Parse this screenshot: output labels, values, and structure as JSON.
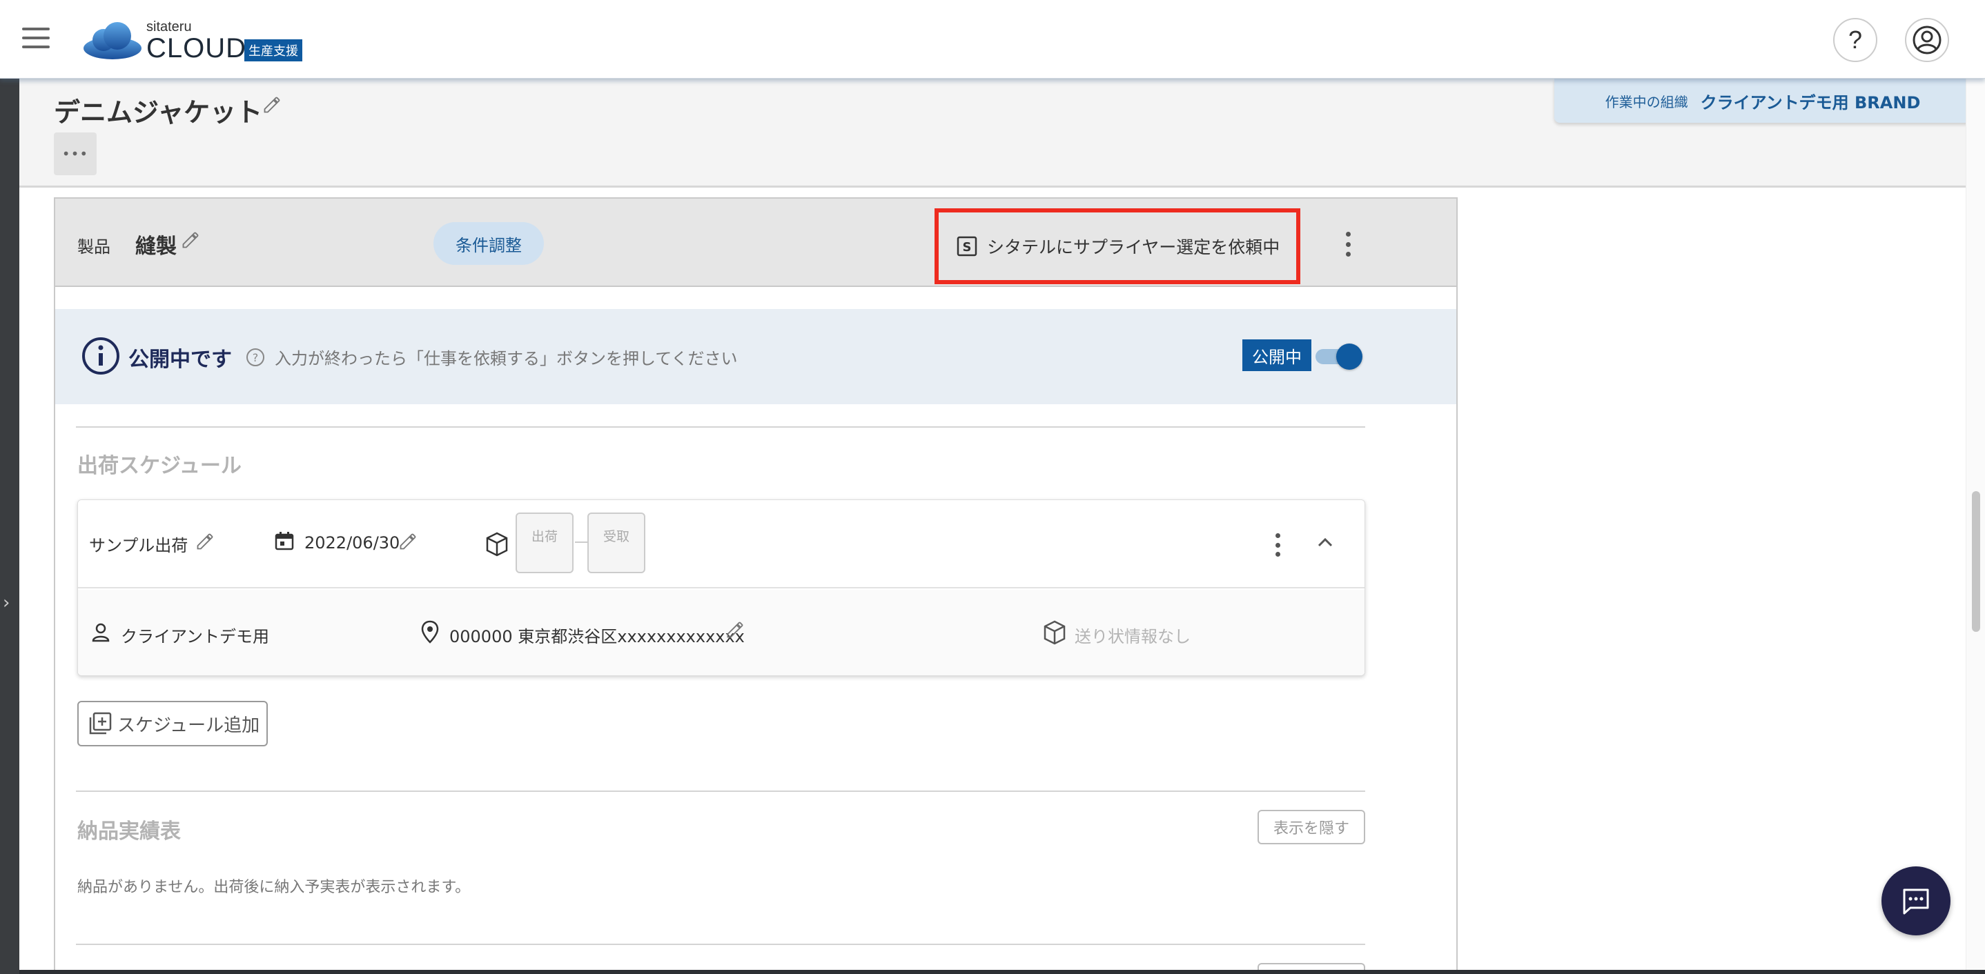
{
  "header": {
    "logo_small": "sitateru",
    "logo_big": "CLOUD",
    "logo_tag": "生産支援",
    "help_label": "?"
  },
  "page": {
    "title": "デニムジャケット",
    "more_label": "•••"
  },
  "org": {
    "label": "作業中の組織",
    "name": "クライアントデモ用 BRAND"
  },
  "product": {
    "label": "製品",
    "name": "縫製",
    "chip": "条件調整",
    "status": "シタテルにサプライヤー選定を依頼中",
    "status_icon_letter": "S"
  },
  "notice": {
    "title": "公開中です",
    "text": "入力が終わったら「仕事を依頼する」ボタンを押してください",
    "badge": "公開中",
    "toggle_on": true
  },
  "schedule": {
    "section_title": "出荷スケジュール",
    "item": {
      "name": "サンプル出荷",
      "date": "2022/06/30",
      "steps": [
        "出荷",
        "受取"
      ],
      "client": "クライアントデモ用",
      "address": "000000 東京都渋谷区xxxxxxxxxxxxx",
      "tracking": "送り状情報なし"
    },
    "add_label": "スケジュール追加"
  },
  "delivery": {
    "section_title": "納品実績表",
    "hide_label": "表示を隠す",
    "empty_message": "納品がありません。出荷後に納入予実表が表示されます。"
  },
  "colors": {
    "brand_blue": "#0f5aa0",
    "highlight_red": "#ee2b1f",
    "chat_navy": "#22224a"
  }
}
